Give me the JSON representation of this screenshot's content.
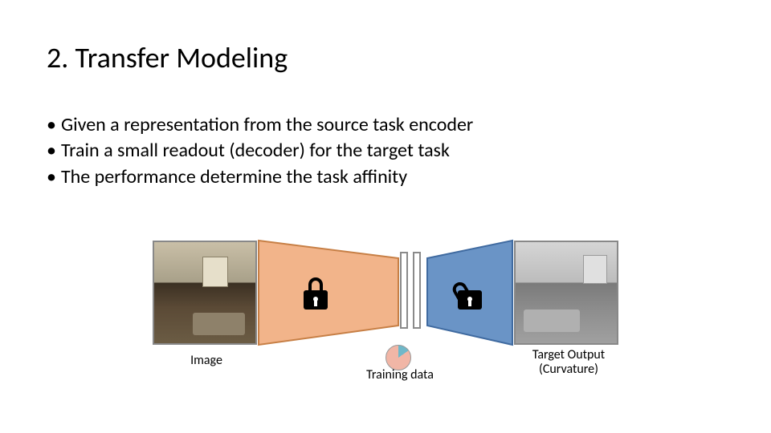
{
  "title": "2. Transfer Modeling",
  "bullets": [
    "Given a representation from the source task encoder",
    "Train a small readout (decoder) for the target task",
    "The performance determine the task affinity"
  ],
  "diagram": {
    "input_label": "Image",
    "training_label": "Training data",
    "output_label_line1": "Target Output",
    "output_label_line2": "(Curvature)",
    "encoder_color": "#f2b48a",
    "decoder_color": "#6a94c6",
    "encoder_locked": true,
    "decoder_locked": false
  }
}
